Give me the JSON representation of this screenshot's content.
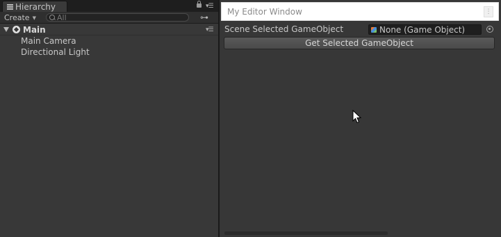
{
  "hierarchy": {
    "tab_label": "Hierarchy",
    "create_label": "Create",
    "search_placeholder": "All",
    "scene_name": "Main",
    "items": [
      {
        "label": "Main Camera"
      },
      {
        "label": "Directional Light"
      }
    ],
    "icons": {
      "tab": "list-icon",
      "lock": "lock-icon",
      "menu": "tab-menu-icon",
      "search": "search-icon",
      "filter": "filter-icon",
      "scene": "unity-logo-icon",
      "foldout": "foldout-arrow-icon"
    }
  },
  "editor_window": {
    "title": "My Editor Window",
    "field_label": "Scene Selected GameObject",
    "field_value": "None (Game Object)",
    "button_label": "Get Selected GameObject",
    "icons": {
      "field": "gameobject-cube-icon",
      "picker": "object-picker-icon",
      "menu": "window-menu-icon"
    }
  },
  "colors": {
    "panel_bg": "#383838",
    "editor_bg": "#373737",
    "title_bar_bg": "#ffffff",
    "text": "#c8c8c8"
  }
}
